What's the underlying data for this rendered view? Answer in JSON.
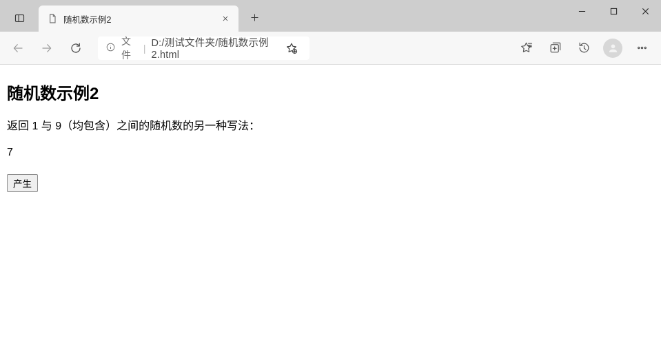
{
  "window": {
    "tab_title": "随机数示例2"
  },
  "toolbar": {
    "scheme_label": "文件",
    "url": "D:/测试文件夹/随机数示例2.html"
  },
  "page": {
    "heading": "随机数示例2",
    "description": "返回 1 与 9（均包含）之间的随机数的另一种写法：",
    "result": "7",
    "button_label": "产生"
  }
}
